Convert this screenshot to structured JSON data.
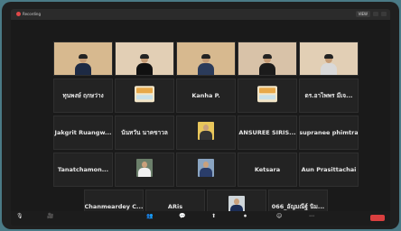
{
  "app": {
    "recording_label": "Recording",
    "view_label": "VIEW"
  },
  "tiles": [
    {
      "name": "",
      "label": "",
      "kind": "video"
    },
    {
      "name": "",
      "label": "",
      "kind": "video"
    },
    {
      "name": "",
      "label": "",
      "kind": "video"
    },
    {
      "name": "",
      "label": "",
      "kind": "video"
    },
    {
      "name": "",
      "label": "",
      "kind": "video"
    },
    {
      "name": "ทุนพงษ์ ฤกษว่าง",
      "label": "",
      "kind": "name"
    },
    {
      "name": "",
      "label": "",
      "kind": "thumb"
    },
    {
      "name": "Kanha P.",
      "label": "",
      "kind": "name"
    },
    {
      "name": "",
      "label": "",
      "kind": "thumb"
    },
    {
      "name": "ดร.อาไพพร มีเจ...",
      "label": "",
      "kind": "name"
    },
    {
      "name": "Jakgrit Ruangw...",
      "label": "",
      "kind": "name"
    },
    {
      "name": "นันทวัน นาคขาวล",
      "label": "",
      "kind": "name"
    },
    {
      "name": "",
      "label": "",
      "kind": "photo"
    },
    {
      "name": "ANSUREE SIRIS...",
      "label": "",
      "kind": "name"
    },
    {
      "name": "supranee phimtra",
      "label": "",
      "kind": "name"
    },
    {
      "name": "Tanatchamon...",
      "label": "",
      "kind": "name"
    },
    {
      "name": "",
      "label": "",
      "kind": "photo"
    },
    {
      "name": "",
      "label": "",
      "kind": "photo"
    },
    {
      "name": "Ketsara",
      "label": "",
      "kind": "name"
    },
    {
      "name": "Aun Prasittachai",
      "label": "",
      "kind": "name"
    },
    {
      "name": "Chanmeardey C...",
      "label": "",
      "kind": "name"
    },
    {
      "name": "ARis",
      "label": "",
      "kind": "name"
    },
    {
      "name": "",
      "label": "",
      "kind": "photo"
    },
    {
      "name": "066_อัญมณีฐ์ นิม...",
      "label": "",
      "kind": "name"
    }
  ],
  "toolbar": [
    {
      "icon": "🎙",
      "label": ""
    },
    {
      "icon": "🎥",
      "label": ""
    },
    {
      "icon": "👥",
      "label": ""
    },
    {
      "icon": "💬",
      "label": ""
    },
    {
      "icon": "⬆",
      "label": ""
    },
    {
      "icon": "⏺",
      "label": ""
    },
    {
      "icon": "☺",
      "label": ""
    },
    {
      "icon": "⋯",
      "label": ""
    }
  ]
}
